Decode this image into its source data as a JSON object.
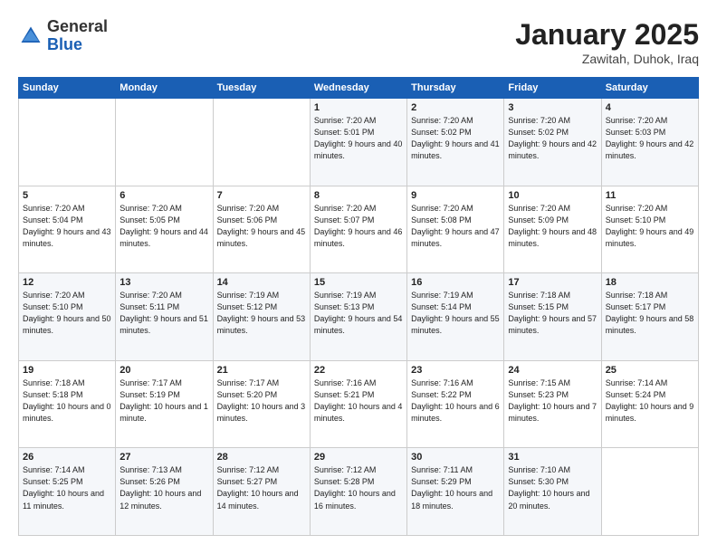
{
  "header": {
    "logo_general": "General",
    "logo_blue": "Blue",
    "month_title": "January 2025",
    "location": "Zawitah, Duhok, Iraq"
  },
  "days_of_week": [
    "Sunday",
    "Monday",
    "Tuesday",
    "Wednesday",
    "Thursday",
    "Friday",
    "Saturday"
  ],
  "weeks": [
    [
      {
        "day": "",
        "info": ""
      },
      {
        "day": "",
        "info": ""
      },
      {
        "day": "",
        "info": ""
      },
      {
        "day": "1",
        "info": "Sunrise: 7:20 AM\nSunset: 5:01 PM\nDaylight: 9 hours\nand 40 minutes."
      },
      {
        "day": "2",
        "info": "Sunrise: 7:20 AM\nSunset: 5:02 PM\nDaylight: 9 hours\nand 41 minutes."
      },
      {
        "day": "3",
        "info": "Sunrise: 7:20 AM\nSunset: 5:02 PM\nDaylight: 9 hours\nand 42 minutes."
      },
      {
        "day": "4",
        "info": "Sunrise: 7:20 AM\nSunset: 5:03 PM\nDaylight: 9 hours\nand 42 minutes."
      }
    ],
    [
      {
        "day": "5",
        "info": "Sunrise: 7:20 AM\nSunset: 5:04 PM\nDaylight: 9 hours\nand 43 minutes."
      },
      {
        "day": "6",
        "info": "Sunrise: 7:20 AM\nSunset: 5:05 PM\nDaylight: 9 hours\nand 44 minutes."
      },
      {
        "day": "7",
        "info": "Sunrise: 7:20 AM\nSunset: 5:06 PM\nDaylight: 9 hours\nand 45 minutes."
      },
      {
        "day": "8",
        "info": "Sunrise: 7:20 AM\nSunset: 5:07 PM\nDaylight: 9 hours\nand 46 minutes."
      },
      {
        "day": "9",
        "info": "Sunrise: 7:20 AM\nSunset: 5:08 PM\nDaylight: 9 hours\nand 47 minutes."
      },
      {
        "day": "10",
        "info": "Sunrise: 7:20 AM\nSunset: 5:09 PM\nDaylight: 9 hours\nand 48 minutes."
      },
      {
        "day": "11",
        "info": "Sunrise: 7:20 AM\nSunset: 5:10 PM\nDaylight: 9 hours\nand 49 minutes."
      }
    ],
    [
      {
        "day": "12",
        "info": "Sunrise: 7:20 AM\nSunset: 5:10 PM\nDaylight: 9 hours\nand 50 minutes."
      },
      {
        "day": "13",
        "info": "Sunrise: 7:20 AM\nSunset: 5:11 PM\nDaylight: 9 hours\nand 51 minutes."
      },
      {
        "day": "14",
        "info": "Sunrise: 7:19 AM\nSunset: 5:12 PM\nDaylight: 9 hours\nand 53 minutes."
      },
      {
        "day": "15",
        "info": "Sunrise: 7:19 AM\nSunset: 5:13 PM\nDaylight: 9 hours\nand 54 minutes."
      },
      {
        "day": "16",
        "info": "Sunrise: 7:19 AM\nSunset: 5:14 PM\nDaylight: 9 hours\nand 55 minutes."
      },
      {
        "day": "17",
        "info": "Sunrise: 7:18 AM\nSunset: 5:15 PM\nDaylight: 9 hours\nand 57 minutes."
      },
      {
        "day": "18",
        "info": "Sunrise: 7:18 AM\nSunset: 5:17 PM\nDaylight: 9 hours\nand 58 minutes."
      }
    ],
    [
      {
        "day": "19",
        "info": "Sunrise: 7:18 AM\nSunset: 5:18 PM\nDaylight: 10 hours\nand 0 minutes."
      },
      {
        "day": "20",
        "info": "Sunrise: 7:17 AM\nSunset: 5:19 PM\nDaylight: 10 hours\nand 1 minute."
      },
      {
        "day": "21",
        "info": "Sunrise: 7:17 AM\nSunset: 5:20 PM\nDaylight: 10 hours\nand 3 minutes."
      },
      {
        "day": "22",
        "info": "Sunrise: 7:16 AM\nSunset: 5:21 PM\nDaylight: 10 hours\nand 4 minutes."
      },
      {
        "day": "23",
        "info": "Sunrise: 7:16 AM\nSunset: 5:22 PM\nDaylight: 10 hours\nand 6 minutes."
      },
      {
        "day": "24",
        "info": "Sunrise: 7:15 AM\nSunset: 5:23 PM\nDaylight: 10 hours\nand 7 minutes."
      },
      {
        "day": "25",
        "info": "Sunrise: 7:14 AM\nSunset: 5:24 PM\nDaylight: 10 hours\nand 9 minutes."
      }
    ],
    [
      {
        "day": "26",
        "info": "Sunrise: 7:14 AM\nSunset: 5:25 PM\nDaylight: 10 hours\nand 11 minutes."
      },
      {
        "day": "27",
        "info": "Sunrise: 7:13 AM\nSunset: 5:26 PM\nDaylight: 10 hours\nand 12 minutes."
      },
      {
        "day": "28",
        "info": "Sunrise: 7:12 AM\nSunset: 5:27 PM\nDaylight: 10 hours\nand 14 minutes."
      },
      {
        "day": "29",
        "info": "Sunrise: 7:12 AM\nSunset: 5:28 PM\nDaylight: 10 hours\nand 16 minutes."
      },
      {
        "day": "30",
        "info": "Sunrise: 7:11 AM\nSunset: 5:29 PM\nDaylight: 10 hours\nand 18 minutes."
      },
      {
        "day": "31",
        "info": "Sunrise: 7:10 AM\nSunset: 5:30 PM\nDaylight: 10 hours\nand 20 minutes."
      },
      {
        "day": "",
        "info": ""
      }
    ]
  ]
}
